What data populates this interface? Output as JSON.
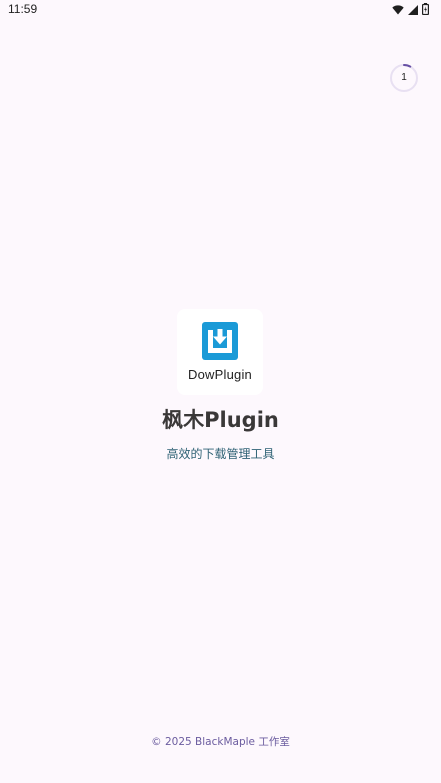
{
  "status_bar": {
    "time": "11:59",
    "icons": [
      "wifi-icon",
      "signal-icon",
      "battery-icon"
    ]
  },
  "countdown": {
    "value": "1",
    "progress": 0.08,
    "accent_color": "#6750a4"
  },
  "logo": {
    "wordmark": "DowPlugin",
    "icon": "download-tray-icon",
    "icon_color": "#1a9ad7"
  },
  "app": {
    "title": "枫木Plugin",
    "subtitle": "高效的下载管理工具"
  },
  "footer": {
    "copyright": "© 2025 BlackMaple 工作室"
  }
}
